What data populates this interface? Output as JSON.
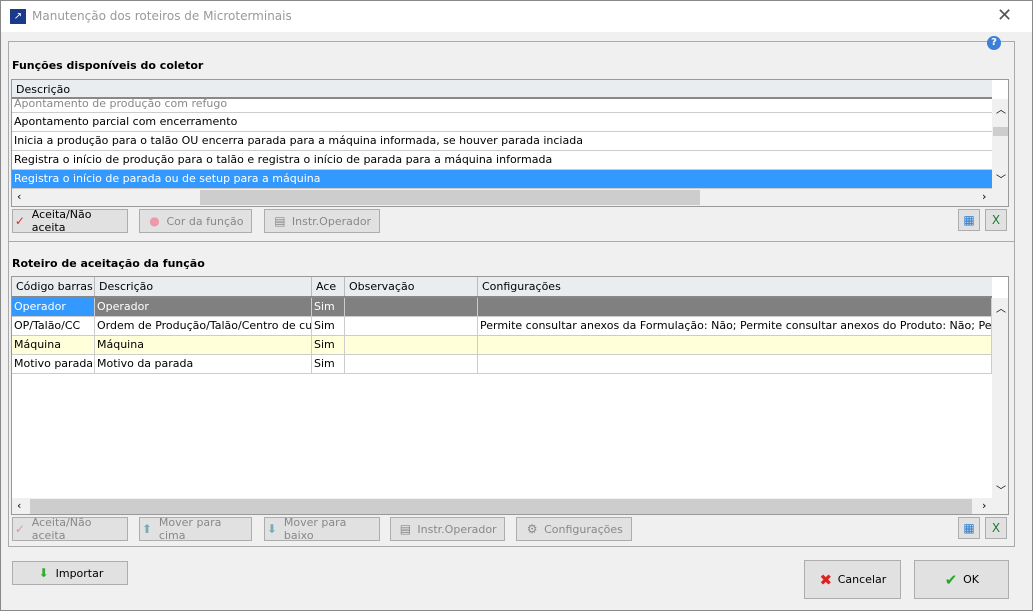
{
  "window": {
    "title": "Manutenção dos roteiros de Microterminais",
    "close": "✕",
    "help": "?"
  },
  "functions": {
    "label": "Funções disponíveis do coletor",
    "column": "Descrição",
    "rows": [
      "Apontamento de produção com refugo",
      "Apontamento parcial com encerramento",
      "Inicia a produção para o talão OU encerra parada para a máquina informada, se houver parada inciada",
      "Registra o início de produção para o talão e registra o início de parada para a máquina informada",
      "Registra o início de parada ou de setup para a máquina"
    ],
    "selected_index": 4,
    "buttons": {
      "accept": "Aceita/Não aceita",
      "color": "Cor da função",
      "instr": "Instr.Operador"
    }
  },
  "route": {
    "label": "Roteiro de aceitação da função",
    "columns": [
      "Código barras",
      "Descrição",
      "Ace",
      "Observação",
      "Configurações"
    ],
    "rows": [
      [
        "Operador",
        "Operador",
        "Sim",
        "",
        ""
      ],
      [
        "OP/Talão/CC",
        "Ordem de Produção/Talão/Centro de custo",
        "Sim",
        "",
        "Permite consultar anexos da Formulação: Não; Permite consultar anexos do Produto: Não; Permite consu"
      ],
      [
        "Máquina",
        "Máquina",
        "Sim",
        "",
        ""
      ],
      [
        "Motivo parada",
        "Motivo da parada",
        "Sim",
        "",
        ""
      ]
    ],
    "buttons": {
      "accept": "Aceita/Não aceita",
      "up": "Mover para cima",
      "down": "Mover para baixo",
      "instr": "Instr.Operador",
      "config": "Configurações"
    }
  },
  "footer": {
    "import": "Importar",
    "cancel": "Cancelar",
    "ok": "OK"
  },
  "colors": {
    "selection": "#3399ff",
    "current_row": "#808080",
    "highlight_row": "#ffffd9"
  }
}
